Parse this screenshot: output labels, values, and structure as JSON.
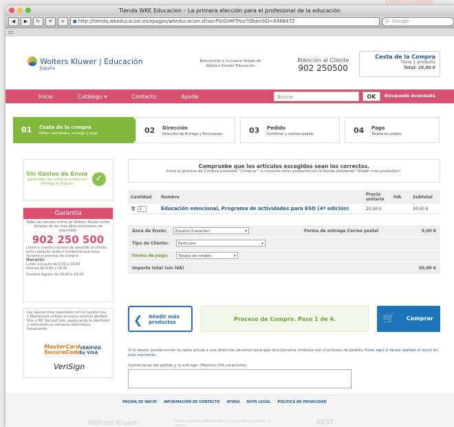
{
  "browser": {
    "title": "Tienda WKE Educacion – La primera elección para el profesional de la educación",
    "url": "http://tienda.wkeducacion.es/epages/wkeducacion.sf/secPSrDiMFTrto/?ObjectID=6988472",
    "search_placeholder": "Q- Google",
    "bookmark_icon_label": "▭",
    "overlay_label": "Distribuidores"
  },
  "header": {
    "brand": "Wolters Kluwer",
    "brand_sep": "Educación",
    "brand_sub": "España",
    "welcome": "Bienvenido a la nueva tienda de Wolters Kluwer Educación",
    "atencion_label": "Atención al Cliente",
    "atencion_phone": "902 250500",
    "cart_title": "Cesta de la Compra",
    "cart_items": "Tiene 1 producto",
    "cart_total": "Total: 20,00 €"
  },
  "nav": {
    "items": [
      "Inicio",
      "Catálogo ▾",
      "Contacto",
      "Ayuda"
    ],
    "search_placeholder": "Buscar",
    "ok": "OK",
    "advanced": "Búsqueda Avanzada"
  },
  "steps": [
    {
      "num": "01",
      "title": "Cesta de la compra",
      "desc": "Editar cantidades, entrega y pago"
    },
    {
      "num": "02",
      "title": "Dirección",
      "desc": "Dirección de Entrega y Facturación"
    },
    {
      "num": "03",
      "title": "Pedido",
      "desc": "Confirmar y realizar pedido"
    },
    {
      "num": "04",
      "title": "Pago",
      "desc": "Tarjeta de crédito"
    }
  ],
  "envio": {
    "title": "Sin Gastos de Envío",
    "desc": "para todas las compras online con entrega en España"
  },
  "garantia": {
    "title": "Garantía",
    "text": "Todas las tiendas online de Wolters Kluwer están dotadas de los más altos estándares de seguridad.",
    "phone": "902 250 500",
    "text2": "Llame a nuestro número de atención al cliente, ante cualquier duda o incidencia que surja durante el proceso de compra.",
    "horario_label": "Horario:",
    "horario1": "Lunes a Jueves de 9.00 a 19.00",
    "horario2": "Viernes de 9.00 a 14.30",
    "horario3": "Durante Agosto de 08:00 a 15:00"
  },
  "security": {
    "text": "Las operaciones realizadas con su tarjeta Visa o Mastercard utilizan el nuevo servicio Verified Visa y MC SecureCode, asegurando la identidad y reduciendo el comercio electrónico fraudulento.",
    "mc": "MasterCard SecureCode",
    "vbv": "VERIFIED by VISA",
    "verisign": "VeriSign"
  },
  "message": {
    "title": "Compruebe que los artículos escogidos sean los correctos.",
    "desc": "Inicie el proceso de Compra pulsando \"Comprar\", o consulte otros productos en la tienda utilizando \"Añadir más productos\"."
  },
  "table": {
    "headers": [
      "Cantidad",
      "Nombre",
      "Precio unitario",
      "IVA",
      "Subtotal"
    ],
    "rows": [
      {
        "qty": "1",
        "name": "Educación emocional, Programa de actividades para ESO (4ª edición)",
        "price": "20,00 €",
        "iva": "",
        "subtotal": "20,00 €"
      }
    ]
  },
  "form": {
    "zona_label": "Zona de Envío:",
    "zona_value": "España (Canarias)",
    "forma_entrega_label": "Forma de entrega Correo postal",
    "forma_entrega_value": "0,00 €",
    "tipo_label": "Tipo de Cliente:",
    "tipo_value": "Particular",
    "pago_label": "Forma de pago:",
    "pago_value": "Tarjeta de crédito",
    "total_label": "Importe total (sin IVA)",
    "total_value": "20,00 €"
  },
  "actions": {
    "add": "Añadir más productos",
    "process": "Proceso de Compra. Paso 1 de 4.",
    "buy": "Comprar"
  },
  "send": {
    "text": "Si lo desea, puede enviar la cesta actual a una dirección de email para que otra persona continúe con el proceso de pedido.",
    "link": "Pulse aquí si desea realizar el envío en este momento.",
    "comments_label": "Comentarios del pedido y la entrega: (Máximo 255 caracteres)"
  },
  "footer": {
    "links": [
      "PÁGINA DE INICIO",
      "INFORMACIÓN DE CONTACTO",
      "AYUDA",
      "NOTA LEGAL",
      "POLÍTICA DE PRIVACIDAD"
    ],
    "brand": "Wolters Kluwer",
    "text": "En las empresas Wolters Kluwer sostenible el entorno el cliente...",
    "badge": "BEST"
  }
}
